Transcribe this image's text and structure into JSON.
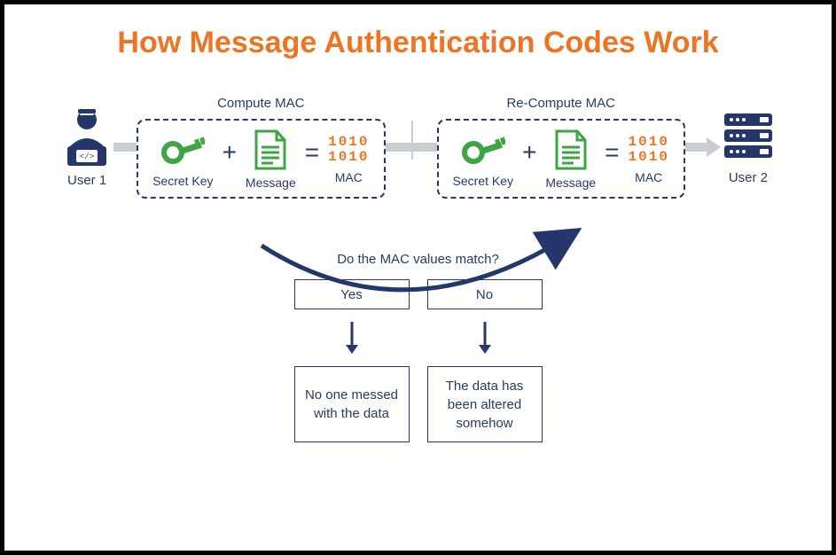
{
  "title": "How Message Authentication Codes Work",
  "users": {
    "left": "User 1",
    "right": "User 2"
  },
  "groups": {
    "compute": {
      "title": "Compute MAC",
      "secretKey": "Secret Key",
      "message": "Message",
      "mac": "MAC",
      "plus": "+",
      "equals": "=",
      "macLine1": "1010",
      "macLine2": "1010"
    },
    "recompute": {
      "title": "Re-Compute MAC",
      "secretKey": "Secret Key",
      "message": "Message",
      "mac": "MAC",
      "plus": "+",
      "equals": "=",
      "macLine1": "1010",
      "macLine2": "1010"
    }
  },
  "question": "Do the MAC values match?",
  "answers": {
    "yes": {
      "label": "Yes",
      "result": "No one messed with the data"
    },
    "no": {
      "label": "No",
      "result": "The data has been altered somehow"
    }
  },
  "colors": {
    "accent": "#ed7422",
    "navy": "#24366a",
    "green": "#3fa544",
    "grey": "#c9cdd2"
  }
}
